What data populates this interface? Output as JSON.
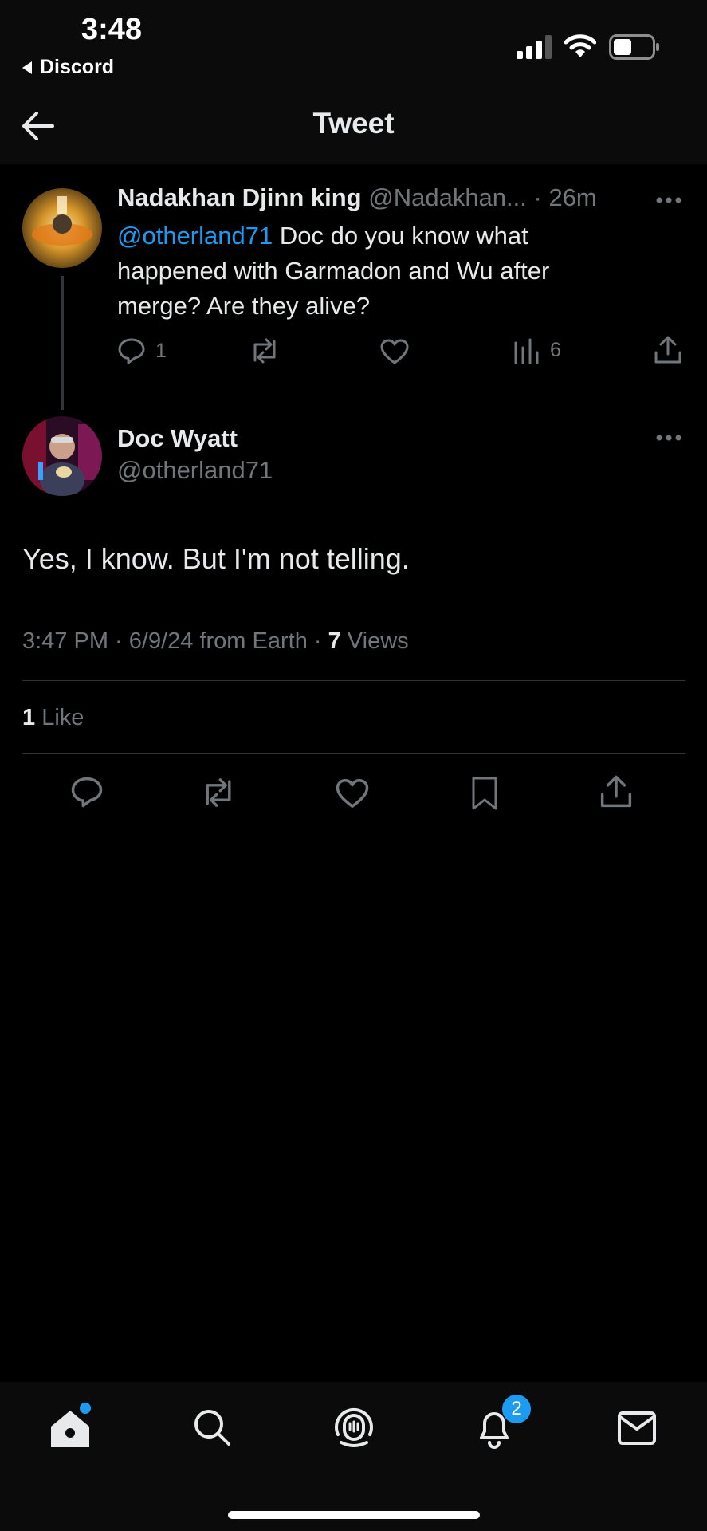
{
  "status_bar": {
    "time": "3:48",
    "back_app": "Discord",
    "icons": [
      "signal-icon",
      "wifi-icon",
      "battery-icon"
    ]
  },
  "header": {
    "title": "Tweet",
    "back_icon": "arrow-left-icon"
  },
  "parent_tweet": {
    "author_name": "Nadakhan Djinn king",
    "author_handle": "@Nadakhan...",
    "separator": "·",
    "time_ago": "26m",
    "mention": "@otherland71",
    "text_line1_rest": " Doc do you know what",
    "text_line2": "happened with Garmadon and Wu after",
    "text_line3": "merge? Are they alive?",
    "reply_count": "1",
    "views_count": "6"
  },
  "main_tweet": {
    "author_name": "Doc Wyatt",
    "author_handle": "@otherland71",
    "text": "Yes, I know. But I'm not telling.",
    "meta_time": "3:47 PM · 6/9/24 from Earth · ",
    "views_count": "7",
    "views_label": " Views",
    "likes_count": "1",
    "likes_label": " Like"
  },
  "tab_bar": {
    "items": [
      "home-icon",
      "search-icon",
      "spaces-icon",
      "notifications-icon",
      "messages-icon"
    ],
    "notification_badge": "2"
  },
  "colors": {
    "background": "#000000",
    "text": "#e7e9ea",
    "muted": "#71767b",
    "accent": "#1d9bf0"
  }
}
